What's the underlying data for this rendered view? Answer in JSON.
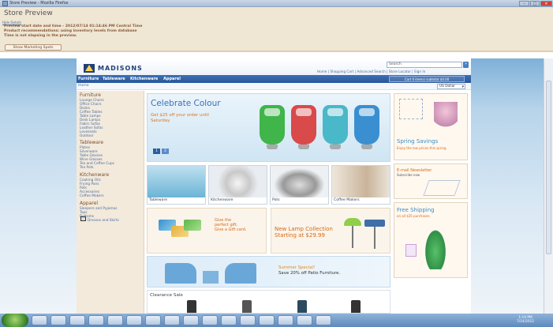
{
  "window": {
    "title": "Store Preview - Mozilla Firefox",
    "controls": [
      "–",
      "□",
      "✕"
    ]
  },
  "preview": {
    "title": "Store Preview",
    "hide_link": "Hide Details",
    "lines": [
      "Preview start date and time - 2012/07/14 01:14:46 PM Central Time",
      "Product recommendations: using inventory levels from database",
      "Time is not elapsing in the preview."
    ],
    "marketing_button": "Show Marketing Spots"
  },
  "store": {
    "brand": "MADISONS",
    "search_placeholder": "Search",
    "search_go": "»",
    "top_links": "Home | Shopping Cart | Advanced Search | Store Locator | Sign In",
    "nav": [
      "Furniture",
      "Tableware",
      "Kitchenware",
      "Apparel"
    ],
    "cart": "Cart 0 items) subtotal $0.00",
    "breadcrumb": "Home",
    "currency": "US Dollar"
  },
  "sidebar": {
    "sections": [
      {
        "heading": "Furniture",
        "items": [
          "Lounge Chairs",
          "Office Chairs",
          "Desks",
          "Coffee Tables",
          "Table Lamps",
          "Desk Lamps",
          "Fabric Sofas",
          "Leather Sofas",
          "Loveseats",
          "Outdoor"
        ]
      },
      {
        "heading": "Tableware",
        "items": [
          "Plates",
          "Silverware",
          "Table Glasses",
          "Wine Glasses",
          "Tea and Coffee Cups",
          "Tea Pots"
        ]
      },
      {
        "heading": "Kitchenware",
        "items": [
          "Cooking Oils",
          "Frying Pans",
          "Pots",
          "Accessories",
          "Coffee Makers"
        ]
      },
      {
        "heading": "Apparel",
        "items": [
          "Sleepers and Pyjamas",
          "Tops",
          "Bottoms"
        ]
      }
    ],
    "selected_item": "Dresses and Skirts"
  },
  "hero": {
    "title": "Celebrate Colour",
    "subtitle_1": "Get $25 off your order until",
    "subtitle_2": "Saturday",
    "pages": [
      "1",
      "2"
    ],
    "kettle_colors": [
      "#3fb54a",
      "#d94a4a",
      "#49b8c8",
      "#3a8fd0"
    ]
  },
  "tiles": [
    "Tableware",
    "Kitchenware",
    "Pots",
    "Coffee Makers"
  ],
  "promos": {
    "gift_1": "Give the",
    "gift_2": "perfect gift.",
    "gift_3": "Give a Gift card.",
    "lamp_1": "New Lamp Collection",
    "lamp_2": "Starting at $29.99"
  },
  "summer": {
    "title": "Summer Special!",
    "text": "Save 20% off Patio Furniture."
  },
  "clearance": {
    "heading": "Clearance Sale"
  },
  "right": {
    "spring_title": "Spring Savings",
    "spring_sub": "Enjoy the low prices this spring",
    "newsletter_title": "E-mail Newsletter",
    "newsletter_sub": "Subscribe now",
    "shipping_title": "Free Shipping",
    "shipping_sub": "on all $35 purchases"
  },
  "taskbar": {
    "time": "1:14 PM",
    "date": "7/14/2012"
  }
}
